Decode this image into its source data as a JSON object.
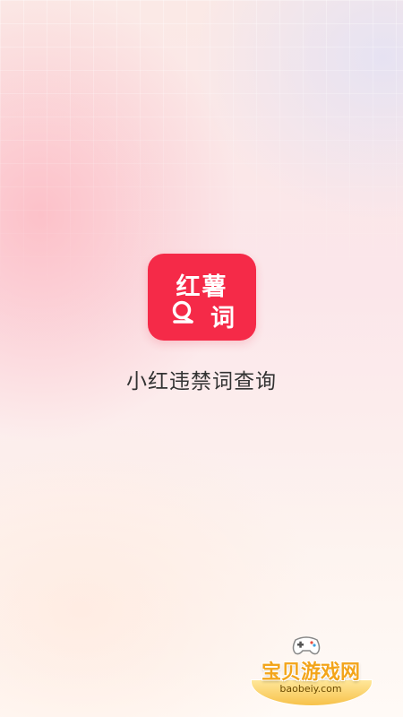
{
  "splash": {
    "logo": {
      "line1": "红薯",
      "line2": "词",
      "magnifier_icon": "magnifier-icon",
      "color": "#f52a48"
    },
    "app_name": "小红违禁词查询"
  },
  "watermark": {
    "icon": "gamepad-icon",
    "name": "宝贝游戏网",
    "url": "baobeiy.com",
    "color": "#f3a51b"
  }
}
